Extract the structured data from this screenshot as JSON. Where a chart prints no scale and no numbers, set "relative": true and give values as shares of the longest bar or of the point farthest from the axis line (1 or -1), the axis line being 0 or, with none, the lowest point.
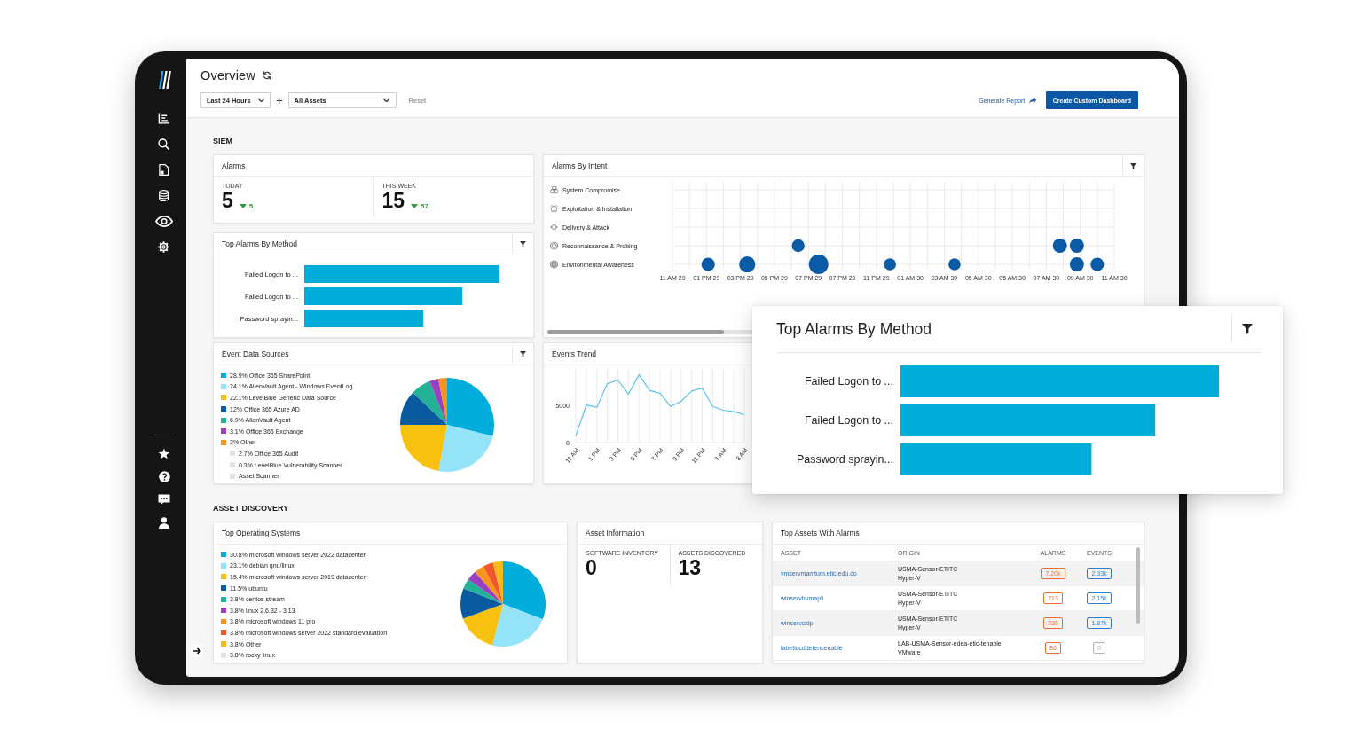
{
  "header": {
    "title": "Overview",
    "filters": [
      {
        "value": "Last 24 Hours"
      },
      {
        "value": "All Assets"
      }
    ],
    "add_filter": "+",
    "reset": "Reset",
    "generate_report": "Generate Report",
    "create_dashboard": "Create Custom Dashboard"
  },
  "siem": {
    "heading": "SIEM",
    "alarms": {
      "title": "Alarms",
      "stats": [
        {
          "label": "TODAY",
          "value": "5",
          "change": "5",
          "down": true
        },
        {
          "label": "THIS WEEK",
          "value": "15",
          "change": "57",
          "down": true
        }
      ]
    },
    "top_alarms_by_method": {
      "title": "Top Alarms By Method",
      "chart_data": {
        "type": "bar",
        "orientation": "horizontal",
        "relative": true,
        "categories": [
          "Failed Logon to ...",
          "Failed Logon to ...",
          "Password sprayin..."
        ],
        "values": [
          1,
          0.81,
          0.61
        ]
      }
    },
    "alarms_by_intent": {
      "title": "Alarms By Intent",
      "intents": [
        {
          "label": "System Compromise"
        },
        {
          "label": "Exploitation & Installation"
        },
        {
          "label": "Delivery & Attack"
        },
        {
          "label": "Reconnaissance & Probing"
        },
        {
          "label": "Environmental Awareness"
        }
      ],
      "time_labels": [
        "11 AM 29",
        "01 PM 29",
        "03 PM 29",
        "05 PM 29",
        "07 PM 29",
        "07 PM 29",
        "11 PM 29",
        "01 AM 30",
        "03 AM 30",
        "05 AM 30",
        "05 AM 30",
        "07 AM 30",
        "09 AM 30",
        "11 AM 30"
      ]
    },
    "event_data_sources": {
      "title": "Event Data Sources",
      "chart_data": {
        "type": "pie",
        "legend": true,
        "categories": [
          "28.9% Office 365 SharePoint",
          "24.1% AlienVault Agent - Windows EventLog",
          "22.1% LevelBlue Generic Data Source",
          "12% Office 365 Azure AD",
          "6.9% AlienVault Agent",
          "3.1% Office 365 Exchange",
          "3% Other"
        ],
        "values": [
          28.9,
          24.1,
          22.1,
          12,
          6.9,
          3.1,
          3
        ]
      },
      "other_breakdown": [
        {
          "label": "2.7% Office 365 Audit"
        },
        {
          "label": "0.3% LevelBlue Vulnerability Scanner"
        },
        {
          "label": "Asset Scanner"
        }
      ]
    },
    "events_trend": {
      "title": "Events Trend",
      "chart_data": {
        "type": "line",
        "grid": true,
        "categories": [
          "11 AM",
          null,
          "1 PM",
          null,
          "3 PM",
          null,
          "5 PM",
          null,
          "7 PM",
          null,
          "9 PM",
          null,
          "11 PM",
          null,
          "1 AM",
          null,
          "3 AM"
        ],
        "series": [
          {
            "color": "#5cc4ec",
            "values": [
              900,
              5100,
              4800,
              8000,
              8500,
              6600,
              9200,
              7100,
              6700,
              4900,
              5600,
              7000,
              7400,
              4900,
              4400,
              4200,
              3800
            ]
          }
        ],
        "ylim": [
          0,
          10000
        ],
        "yticks": [
          0,
          5000
        ]
      }
    }
  },
  "asset_discovery": {
    "heading": "ASSET DISCOVERY",
    "top_operating_systems": {
      "title": "Top Operating Systems",
      "chart_data": {
        "type": "pie",
        "legend": true,
        "categories": [
          "30.8% microsoft windows server 2022 datacenter",
          "23.1% debian gnu/linux",
          "15.4% microsoft windows server 2019 datacenter",
          "11.5% ubuntu",
          "3.8% centos stream",
          "3.8% linux 2.6.32 - 3.13",
          "3.8% microsoft windows 11 pro",
          "3.8% microsoft windows server 2022 standard evaluation",
          "3.8% Other",
          "3.8% rocky linux"
        ],
        "values": [
          30.8,
          23.1,
          15.4,
          11.5,
          3.8,
          3.8,
          3.8,
          3.8,
          3.8,
          null
        ]
      }
    },
    "asset_information": {
      "title": "Asset Information",
      "stats": [
        {
          "label": "SOFTWARE INVENTORY",
          "value": "0"
        },
        {
          "label": "ASSETS DISCOVERED",
          "value": "13"
        }
      ]
    },
    "top_assets_with_alarms": {
      "title": "Top Assets With Alarms",
      "columns": [
        "ASSET",
        "ORIGIN",
        "ALARMS",
        "EVENTS"
      ],
      "rows": [
        {
          "asset": "vmservmamtum.etic.edu.co",
          "origin_sensor": "USMA-Sensor-ETITC",
          "origin_platform": "Hyper-V",
          "alarms": "7.20k",
          "events": {
            "text": "2.33k",
            "color": "#2f7dd1"
          }
        },
        {
          "asset": "winservhumapli",
          "origin_sensor": "USMA-Sensor-ETITC",
          "origin_platform": "Hyper-V",
          "alarms": "713",
          "events": {
            "text": "2.15k",
            "color": "#2f7dd1"
          }
        },
        {
          "asset": "winservcidp",
          "origin_sensor": "USMA-Sensor-ETITC",
          "origin_platform": "Hyper-V",
          "alarms": "235",
          "events": {
            "text": "1.87k",
            "color": "#2f7dd1"
          }
        },
        {
          "asset": "labeticcddetencenable",
          "origin_sensor": "LAB-USMA-Sensor-edea-etic-tenable",
          "origin_platform": "VMware",
          "alarms": "86",
          "events": {
            "text": "0",
            "color": "#b3b3b3"
          }
        }
      ]
    }
  },
  "popup_card": {
    "title": "Top Alarms By Method",
    "chart_data": {
      "type": "bar",
      "orientation": "horizontal",
      "relative": true,
      "categories": [
        "Failed Logon to ...",
        "Failed Logon to ...",
        "Password sprayin..."
      ],
      "values": [
        1,
        0.8,
        0.6
      ]
    }
  }
}
